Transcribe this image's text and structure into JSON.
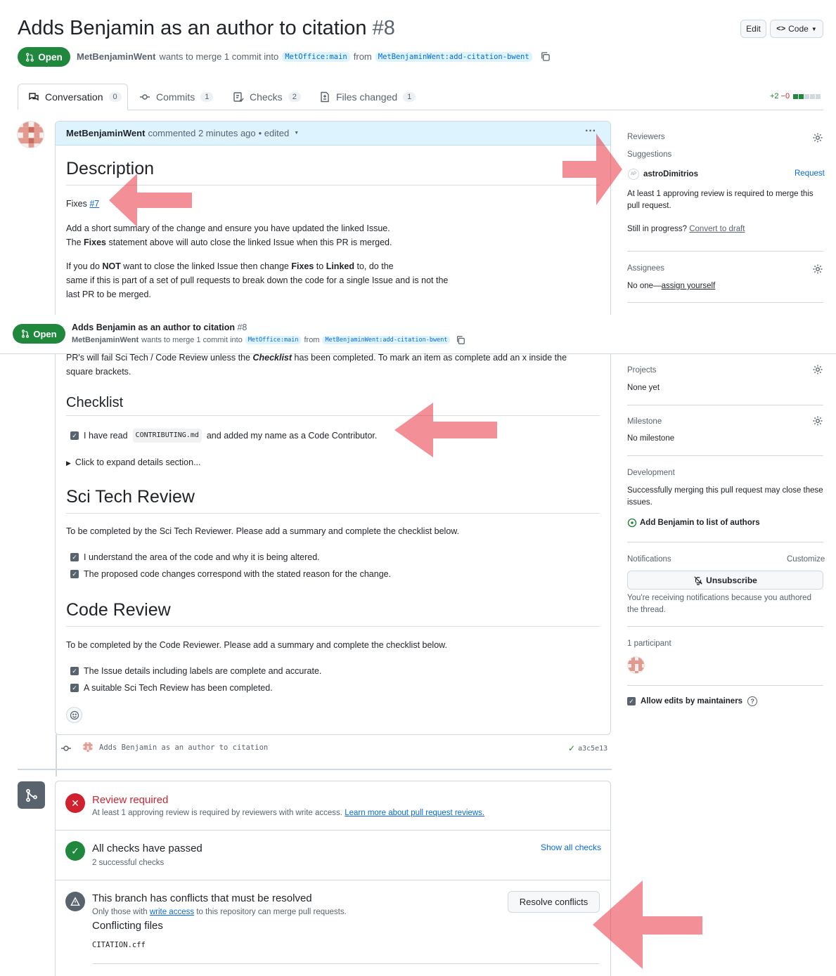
{
  "header": {
    "title": "Adds Benjamin as an author to citation",
    "number": "#8",
    "edit_label": "Edit",
    "code_label": "Code",
    "state_label": "Open",
    "author": "MetBenjaminWent",
    "merge_text": "wants to merge 1 commit into",
    "base_branch": "MetOffice:main",
    "from_text": "from",
    "head_branch": "MetBenjaminWent:add-citation-bwent"
  },
  "tabs": [
    {
      "label": "Conversation",
      "count": "0"
    },
    {
      "label": "Commits",
      "count": "1"
    },
    {
      "label": "Checks",
      "count": "2"
    },
    {
      "label": "Files changed",
      "count": "1"
    }
  ],
  "diffstat": {
    "add": "+2",
    "del": "−0"
  },
  "comment": {
    "author": "MetBenjaminWent",
    "meta": "commented 2 minutes ago",
    "edited": "• edited",
    "more": "···"
  },
  "description": {
    "heading": "Description",
    "fixes_label": "Fixes",
    "fixes_ref": "#7",
    "p1_line1": "Add a short summary of the change and ensure you have updated the linked Issue.",
    "p1_line2_pre": "The ",
    "p1_line2_bold": "Fixes",
    "p1_line2_post": " statement above will auto close the linked Issue when this PR is merged.",
    "p2_line1_a": "If you do ",
    "p2_line1_not": "NOT",
    "p2_line1_b": " want to close the linked Issue then change ",
    "p2_line1_fixes": "Fixes",
    "p2_line1_c": " to ",
    "p2_line1_linked": "Linked",
    "p2_line1_d": " to, do the",
    "p2_line2": "same if this is part of a set of pull requests to break down the code for a single Issue and is not the",
    "p2_line3": "last PR to be merged.",
    "p3_line1_a": "PR's will fail Sci Tech / Code Review unless the ",
    "p3_line1_bold": "Checklist",
    "p3_line1_b": " has been completed. To mark an item as complete add an x inside the",
    "p3_line2": "square brackets."
  },
  "checklist": {
    "heading": "Checklist",
    "item1_a": "I have read",
    "item1_code": "CONTRIBUTING.md",
    "item1_b": "and added my name as a Code Contributor.",
    "details_a": "Click to expand ",
    "details_b": "details section..."
  },
  "scitech": {
    "heading": "Sci Tech Review",
    "intro": "To be completed by the Sci Tech Reviewer. Please add a summary and complete the checklist below.",
    "items": [
      "I understand the area of the code and why it is being altered.",
      "The proposed code changes correspond with the stated reason for the change."
    ]
  },
  "codereview": {
    "heading": "Code Review",
    "intro": "To be completed by the Code Reviewer. Please add a summary and complete the checklist below.",
    "items": [
      "The Issue details including labels are complete and accurate.",
      "A suitable Sci Tech Review has been completed."
    ]
  },
  "commit": {
    "message": "Adds Benjamin as an author to citation",
    "sha": "a3c5e13"
  },
  "merge_box": {
    "review_title": "Review required",
    "review_text": "At least 1 approving review is required by reviewers with write access.",
    "review_link": "Learn more about pull request reviews.",
    "checks_title": "All checks have passed",
    "checks_sub": "2 successful checks",
    "show_checks": "Show all checks",
    "conflict_title": "This branch has conflicts that must be resolved",
    "conflict_text_a": "Only those with",
    "conflict_link": "write access",
    "conflict_text_b": "to this repository can merge pull requests.",
    "resolve_label": "Resolve conflicts",
    "conflicting_files": "Conflicting files",
    "file": "CITATION.cff"
  },
  "sidebar": {
    "reviewers_title": "Reviewers",
    "suggestions": "Suggestions",
    "reviewer_initials": "AP",
    "reviewer": "astroDimitrios",
    "request": "Request",
    "approving_note": "At least 1 approving review is required to merge this pull request.",
    "still_progress": "Still in progress?",
    "convert_draft": "Convert to draft",
    "assignees_title": "Assignees",
    "assignees_none": "No one—",
    "assign_yourself": "assign yourself",
    "projects_title": "Projects",
    "projects_none": "None yet",
    "milestone_title": "Milestone",
    "milestone_none": "No milestone",
    "development_title": "Development",
    "development_note": "Successfully merging this pull request may close these issues.",
    "development_issue": "Add Benjamin to list of authors",
    "notifications_title": "Notifications",
    "customize": "Customize",
    "unsubscribe": "Unsubscribe",
    "notifications_note": "You're receiving notifications because you authored the thread.",
    "participants": "1 participant",
    "allow_edits": "Allow edits by maintainers"
  },
  "colors": {
    "open_green": "#1f883d",
    "link_blue": "#0969da",
    "annotation_arrow": "#e8202e"
  }
}
